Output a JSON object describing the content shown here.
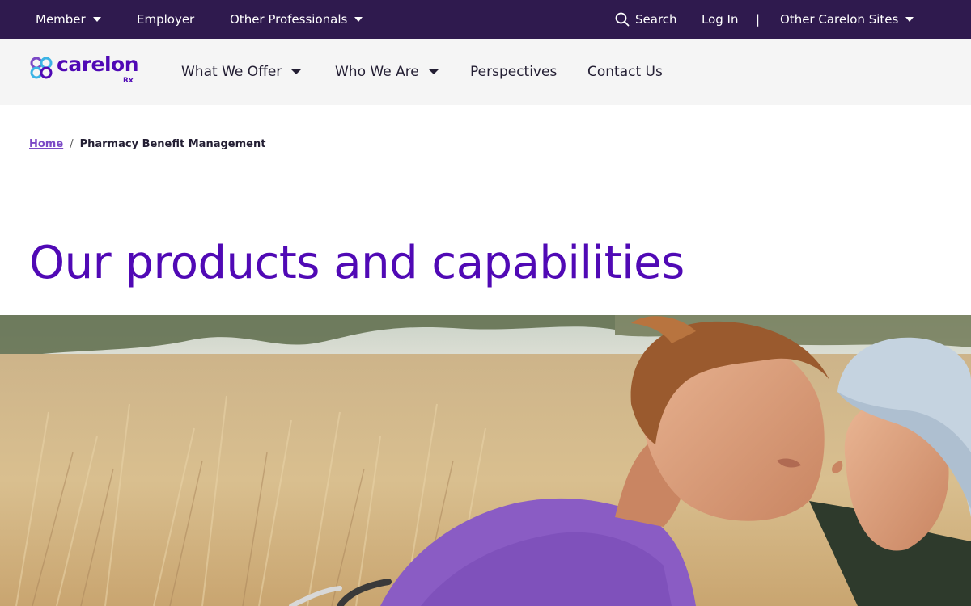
{
  "topbar": {
    "member": "Member",
    "employer": "Employer",
    "other_professionals": "Other Professionals",
    "search": "Search",
    "login": "Log In",
    "separator": "|",
    "other_sites": "Other Carelon Sites"
  },
  "brand": {
    "name": "carelon",
    "suffix": "Rx"
  },
  "nav": {
    "what_we_offer": "What We Offer",
    "who_we_are": "Who We Are",
    "perspectives": "Perspectives",
    "contact_us": "Contact Us"
  },
  "breadcrumb": {
    "home": "Home",
    "separator": "/",
    "current": "Pharmacy Benefit Management"
  },
  "page": {
    "title": "Our products and capabilities"
  },
  "colors": {
    "topbar_bg": "#2f1a4e",
    "nav_bg": "#f5f5f5",
    "brand_purple": "#5009b5",
    "link_purple": "#7b49c6"
  }
}
